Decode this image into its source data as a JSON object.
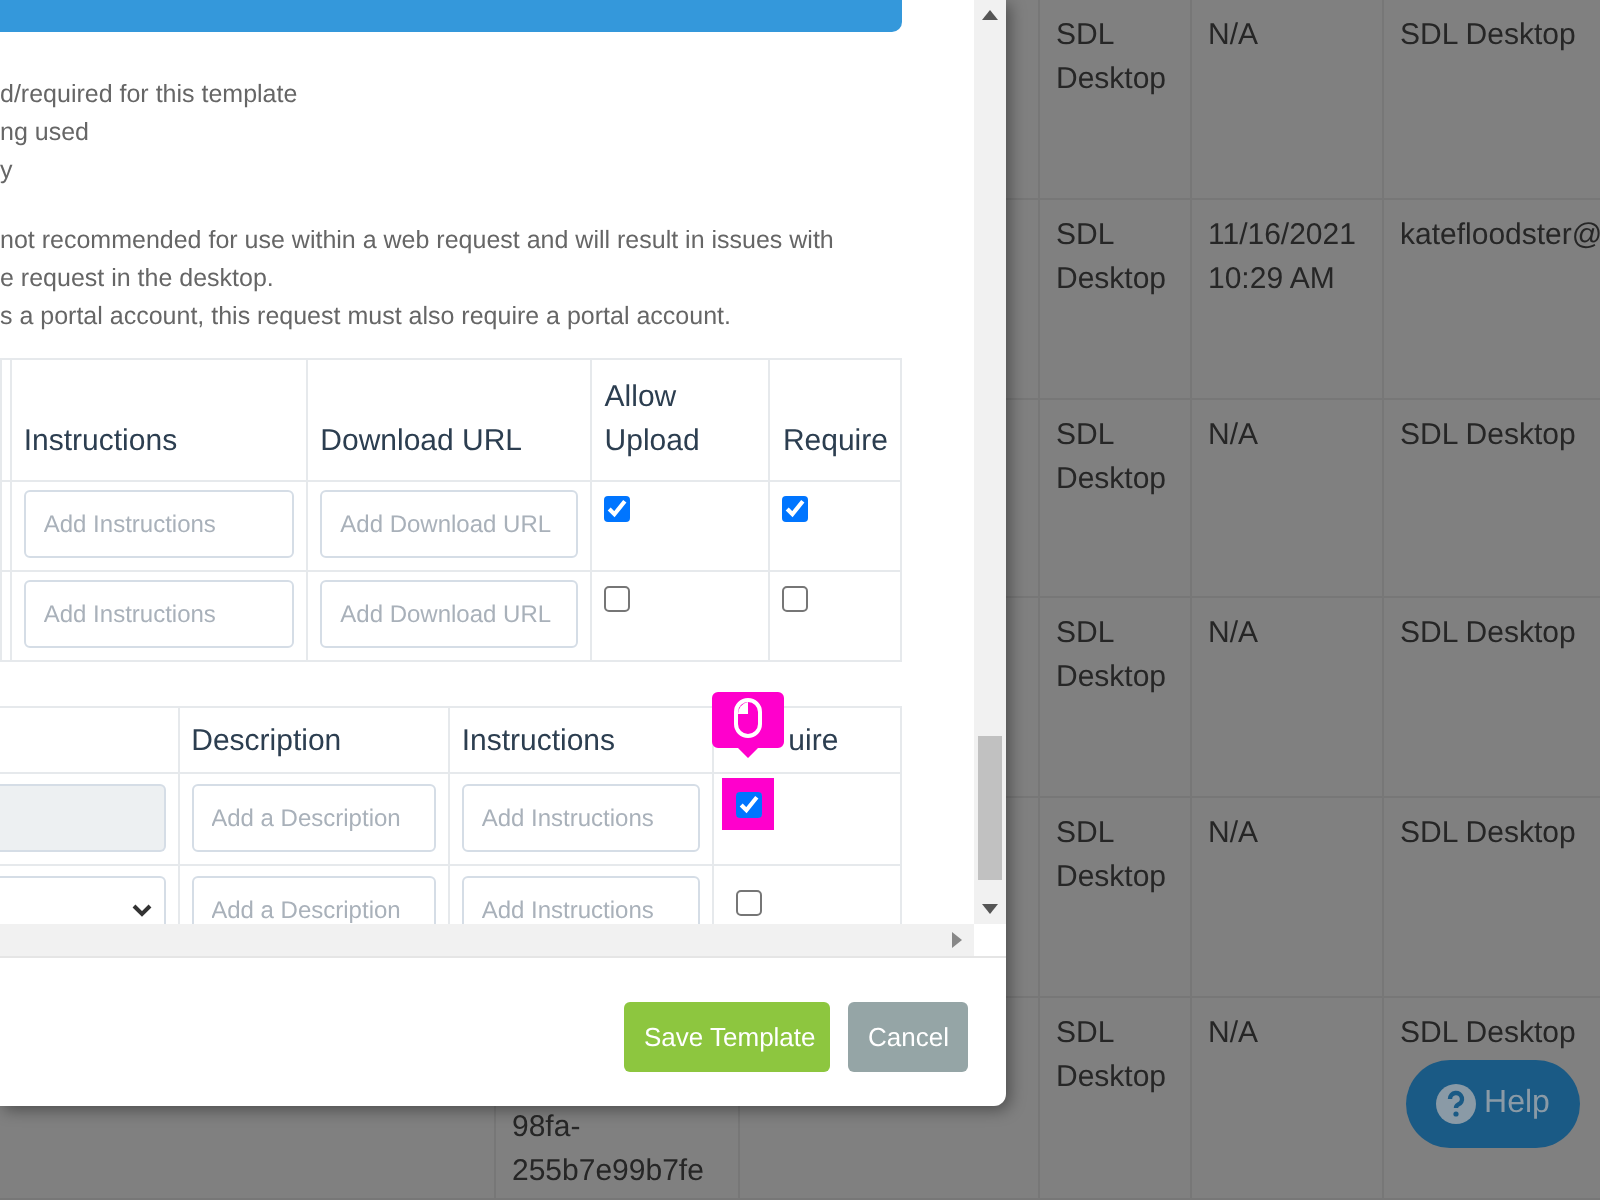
{
  "background_table": {
    "rows": [
      {
        "column_1": "",
        "column_2": "SDL Desktop",
        "column_3": "N/A",
        "column_4": "SDL Desktop"
      },
      {
        "column_1": "",
        "column_2": "SDL Desktop",
        "column_3": "11/16/2021 10:29 AM",
        "column_4": "katefloodster@"
      },
      {
        "column_1": "",
        "column_2": "SDL Desktop",
        "column_3": "N/A",
        "column_4": "SDL Desktop"
      },
      {
        "column_1": "",
        "column_2": "SDL Desktop",
        "column_3": "N/A",
        "column_4": "SDL Desktop"
      },
      {
        "column_1": "",
        "column_2": "SDL Desktop",
        "column_3": "N/A",
        "column_4": "SDL Desktop"
      },
      {
        "column_1": "98fa-255b7e99b7fe",
        "column_2": "SDL Desktop",
        "column_3": "N/A",
        "column_4": "SDL Desktop"
      }
    ]
  },
  "modal": {
    "notes": [
      [
        "d/required for this template",
        "ng used",
        "y"
      ],
      [
        "not recommended for use within a web request and will result in issues with",
        "e request in the desktop.",
        "s a portal account, this request must also require a portal account."
      ]
    ],
    "file_table": {
      "columns": [
        "Instructions",
        "Download URL",
        "Allow Upload",
        "Require"
      ],
      "rows": [
        {
          "instructions_placeholder": "Add Instructions",
          "url_placeholder": "Add Download URL",
          "allow_upload": true,
          "require": true
        },
        {
          "instructions_placeholder": "Add Instructions",
          "url_placeholder": "Add Download URL",
          "allow_upload": false,
          "require": false
        }
      ]
    },
    "field_table": {
      "columns": [
        "Description",
        "Instructions",
        "uire"
      ],
      "rows": [
        {
          "kind": "disabled-input",
          "description_placeholder": "Add a Description",
          "instructions_placeholder": "Add Instructions",
          "require": true,
          "clicked": true
        },
        {
          "kind": "select",
          "description_placeholder": "Add a Description",
          "instructions_placeholder": "Add Instructions",
          "require": false,
          "clicked": false
        }
      ]
    },
    "buttons": [
      {
        "label": "Save Template",
        "kind": "primary"
      },
      {
        "label": "Cancel",
        "kind": "secondary"
      }
    ]
  },
  "help_button": {
    "label": "Help"
  }
}
